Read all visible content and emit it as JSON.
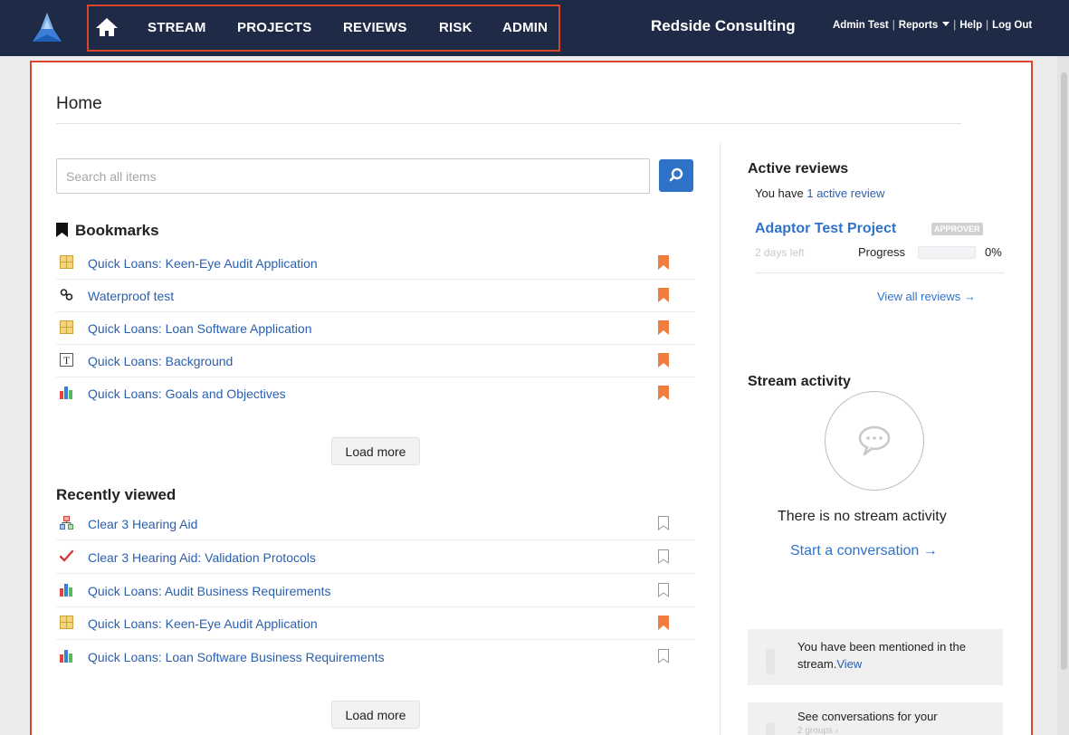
{
  "nav": {
    "items": [
      "STREAM",
      "PROJECTS",
      "REVIEWS",
      "RISK",
      "ADMIN"
    ],
    "company": "Redside Consulting",
    "user": "Admin Test",
    "reports": "Reports",
    "help": "Help",
    "logout": "Log Out",
    "separator": "|"
  },
  "page": {
    "title": "Home"
  },
  "search": {
    "placeholder": "Search all items"
  },
  "bookmarks": {
    "title": "Bookmarks",
    "items": [
      {
        "label": "Quick Loans: Keen-Eye Audit Application",
        "icon": "grid-icon",
        "bookmarked": true
      },
      {
        "label": "Waterproof test",
        "icon": "link-icon",
        "bookmarked": true
      },
      {
        "label": "Quick Loans: Loan Software Application",
        "icon": "grid-icon",
        "bookmarked": true
      },
      {
        "label": "Quick Loans: Background",
        "icon": "text-icon",
        "bookmarked": true
      },
      {
        "label": "Quick Loans: Goals and Objectives",
        "icon": "bar-chart-icon",
        "bookmarked": true
      }
    ],
    "load_more": "Load more"
  },
  "recent": {
    "title": "Recently viewed",
    "items": [
      {
        "label": "Clear 3 Hearing Aid",
        "icon": "hierarchy-icon",
        "bookmarked": false
      },
      {
        "label": "Clear 3 Hearing Aid: Validation Protocols",
        "icon": "checkmark-icon",
        "bookmarked": false
      },
      {
        "label": "Quick Loans: Audit Business Requirements",
        "icon": "bar-chart-icon",
        "bookmarked": false
      },
      {
        "label": "Quick Loans: Keen-Eye Audit Application",
        "icon": "grid-icon",
        "bookmarked": true
      },
      {
        "label": "Quick Loans: Loan Software Business Requirements",
        "icon": "bar-chart-icon",
        "bookmarked": false
      }
    ],
    "load_more": "Load more"
  },
  "active_reviews": {
    "title": "Active reviews",
    "summary_prefix": "You have ",
    "summary_link": "1 active review",
    "project": "Adaptor Test Project",
    "badge": "APPROVER",
    "days_left": "2 days left",
    "progress_label": "Progress",
    "progress_value": 0,
    "progress_text": "0%",
    "view_all": "View all reviews →"
  },
  "stream": {
    "title": "Stream activity",
    "empty": "There is no stream activity",
    "start": "Start a conversation →",
    "mention_text": "You have been mentioned in the stream.",
    "mention_link": "View",
    "groups_text": "See conversations for your",
    "groups_sub": "2 groups ›"
  },
  "colors": {
    "nav_bg": "#1f2b46",
    "highlight": "#d9452b",
    "link": "#2a5fae",
    "accent": "#2f73c9",
    "bookmark_on": "#f07d3e"
  }
}
